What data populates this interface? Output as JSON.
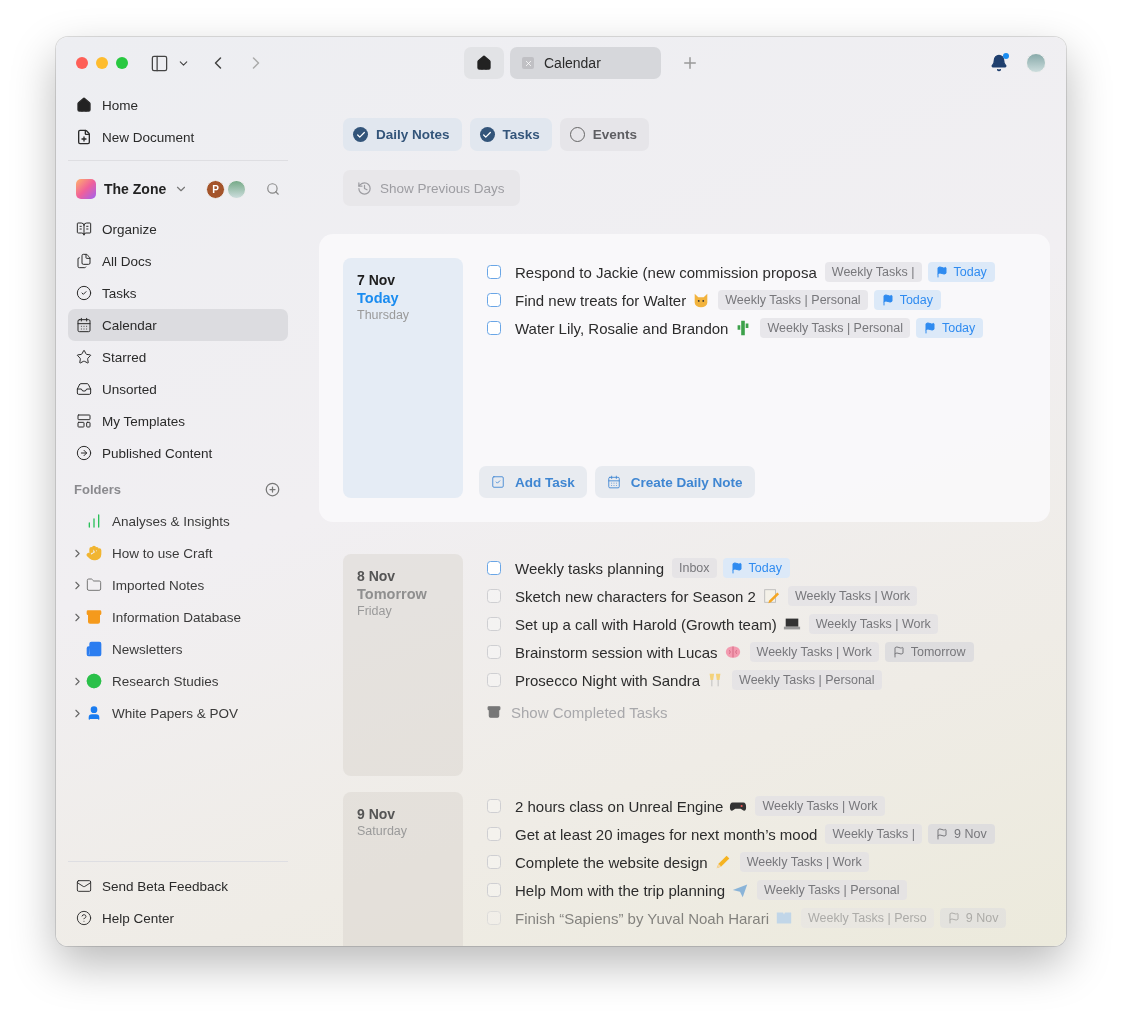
{
  "toolbar": {
    "tabs": [
      {
        "kind": "home",
        "selected": false
      },
      {
        "kind": "page",
        "label": "Calendar",
        "selected": true
      }
    ]
  },
  "sidebar": {
    "top_items": [
      {
        "label": "Home"
      },
      {
        "label": "New Document"
      }
    ],
    "space": {
      "name": "The Zone",
      "member_initial": "P"
    },
    "items": [
      {
        "label": "Organize",
        "selected": false
      },
      {
        "label": "All Docs",
        "selected": false
      },
      {
        "label": "Tasks",
        "selected": false
      },
      {
        "label": "Calendar",
        "selected": true
      },
      {
        "label": "Starred",
        "selected": false
      },
      {
        "label": "Unsorted",
        "selected": false
      },
      {
        "label": "My Templates",
        "selected": false
      },
      {
        "label": "Published Content",
        "selected": false
      }
    ],
    "folders_heading": "Folders",
    "folders": [
      {
        "label": "Analyses & Insights",
        "expandable": false
      },
      {
        "label": "How to use Craft",
        "expandable": true
      },
      {
        "label": "Imported Notes",
        "expandable": true
      },
      {
        "label": "Information Database",
        "expandable": true
      },
      {
        "label": "Newsletters",
        "expandable": false
      },
      {
        "label": "Research Studies",
        "expandable": true
      },
      {
        "label": "White Papers & POV",
        "expandable": true
      }
    ],
    "bottom_items": [
      {
        "label": "Send Beta Feedback"
      },
      {
        "label": "Help Center"
      }
    ]
  },
  "filters": [
    {
      "label": "Daily Notes",
      "checked": true
    },
    {
      "label": "Tasks",
      "checked": true
    },
    {
      "label": "Events",
      "checked": false
    }
  ],
  "show_previous": "Show Previous Days",
  "days": [
    {
      "date": "7 Nov",
      "relative": "Today",
      "weekday": "Thursday",
      "current": true,
      "tasks": [
        {
          "text": "Respond to Jackie (new commission proposa",
          "checked": false,
          "tag": "Weekly Tasks |",
          "due": {
            "kind": "today",
            "label": "Today"
          }
        },
        {
          "text": "Find new treats for Walter",
          "checked": false,
          "tag": "Weekly Tasks | Personal",
          "due": {
            "kind": "today",
            "label": "Today"
          }
        },
        {
          "text": "Water Lily, Rosalie and Brandon",
          "checked": false,
          "tag": "Weekly Tasks | Personal",
          "due": {
            "kind": "today",
            "label": "Today"
          }
        }
      ],
      "actions": [
        "Add Task",
        "Create Daily Note"
      ]
    },
    {
      "date": "8 Nov",
      "relative": "Tomorrow",
      "weekday": "Friday",
      "current": false,
      "tasks": [
        {
          "text": "Weekly tasks planning",
          "checked": false,
          "tag": "Inbox",
          "due": {
            "kind": "today",
            "label": "Today"
          }
        },
        {
          "text": "Sketch new characters for Season 2",
          "checked": false,
          "tag": "Weekly Tasks | Work"
        },
        {
          "text": "Set up a call with Harold (Growth team)",
          "checked": false,
          "tag": "Weekly Tasks | Work"
        },
        {
          "text": "Brainstorm session with Lucas",
          "checked": false,
          "tag": "Weekly Tasks | Work",
          "due": {
            "kind": "later",
            "label": "Tomorrow"
          }
        },
        {
          "text": "Prosecco Night with Sandra",
          "checked": false,
          "tag": "Weekly Tasks | Personal"
        }
      ],
      "completed": "Show Completed Tasks"
    },
    {
      "date": "9 Nov",
      "weekday": "Saturday",
      "current": false,
      "tasks": [
        {
          "text": "2 hours class on Unreal Engine",
          "checked": false,
          "tag": "Weekly Tasks | Work"
        },
        {
          "text": "Get at least 20 images for next month’s mood",
          "checked": false,
          "tag": "Weekly Tasks |",
          "due": {
            "kind": "later",
            "label": "9 Nov"
          }
        },
        {
          "text": "Complete the website design",
          "checked": false,
          "tag": "Weekly Tasks | Work"
        },
        {
          "text": "Help Mom with the trip planning",
          "checked": false,
          "tag": "Weekly Tasks | Personal"
        },
        {
          "text": "Finish “Sapiens” by Yuval Noah Harari",
          "checked": false,
          "tag": "Weekly Tasks | Perso",
          "due": {
            "kind": "later",
            "label": "9 Nov"
          },
          "faded": true
        }
      ]
    }
  ]
}
